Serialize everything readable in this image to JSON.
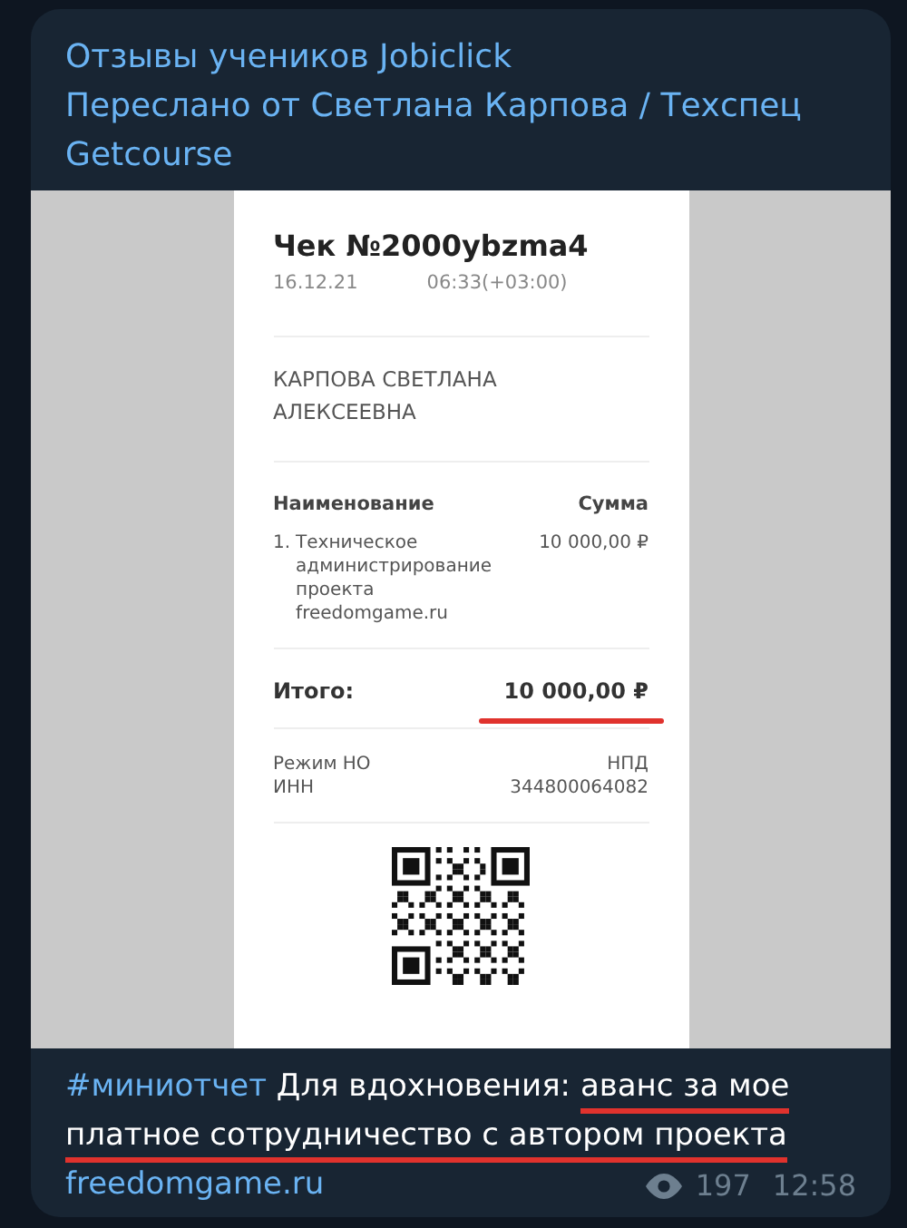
{
  "channel": {
    "title": "Отзывы учеников Jobiclick",
    "forwarded_from": "Переслано от Светлана Карпова / Техспец Getcourse"
  },
  "receipt": {
    "title": "Чек №2000ybzma4",
    "date": "16.12.21",
    "time": "06:33(+03:00)",
    "buyer": "КАРПОВА СВЕТЛАНА АЛЕКСЕЕВНА",
    "columns": [
      "Наименование",
      "Сумма"
    ],
    "items": [
      {
        "number": "1.",
        "name": "Техническое администрирование проекта freedomgame.ru",
        "sum": "10 000,00 ₽"
      }
    ],
    "total_label": "Итого:",
    "total": "10 000,00 ₽",
    "total_underlined": true,
    "details": [
      {
        "label": "Режим НО",
        "value": "НПД"
      },
      {
        "label": "ИНН",
        "value": "344800064082"
      }
    ]
  },
  "caption": {
    "hashtag": "#миниотчет",
    "segments": [
      {
        "text": "Для вдохновения:",
        "underlined": false
      },
      {
        "text": "аванс за мое платное сотрудничество с автором проекта",
        "underlined": true
      }
    ],
    "link": "freedomgame.ru"
  },
  "footer": {
    "views": "197",
    "time": "12:58"
  }
}
